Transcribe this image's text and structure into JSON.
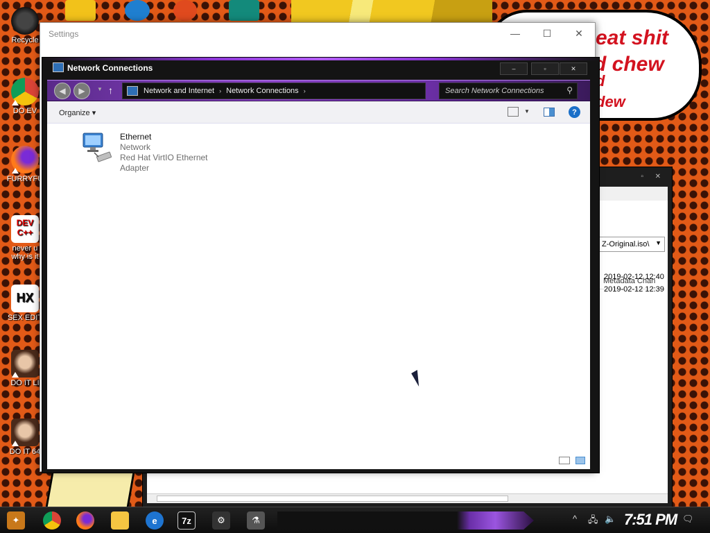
{
  "desktop": {
    "icons": [
      {
        "label": "Recycle"
      },
      {
        "label": "DO EV"
      },
      {
        "label": "FURRYFU"
      },
      {
        "label_line1": "never u",
        "label_line2": "why is it",
        "image_text": "DEV C++"
      },
      {
        "label": "SEX EDIT",
        "image_text": "HX"
      },
      {
        "label": "DO IT LI"
      },
      {
        "label": "DO IT 64"
      }
    ],
    "speech_bubble": [
      "eat shit",
      "d chew",
      "d",
      "dew"
    ]
  },
  "background_window": {
    "address_value": "Z-Original.iso\\",
    "column_header": "Metadata Chan",
    "rows": [
      "2019-02-12 12:40",
      "2019-02-12 12:39"
    ]
  },
  "settings": {
    "title": "Settings",
    "minimize": "—",
    "maximize": "☐",
    "close": "✕"
  },
  "network_window": {
    "title": "Network Connections",
    "controls": {
      "minimize": "–",
      "maximize": "▫",
      "close": "✕"
    },
    "breadcrumb": [
      "Network and Internet",
      "Network Connections"
    ],
    "search_placeholder": "Search Network Connections",
    "organize_label": "Organize",
    "help_label": "?",
    "connection": {
      "name": "Ethernet",
      "network": "Network",
      "adapter": "Red Hat VirtIO Ethernet Adapter"
    }
  },
  "taskbar": {
    "clock": "7:51 PM",
    "sevenzip_label": "7z",
    "tray_icons": [
      "chevron-up-icon",
      "network-icon",
      "speaker-icon"
    ],
    "notification_icon": "action-center-icon"
  },
  "colors": {
    "accent_purple": "#8c44c8",
    "desktop_orange": "#e25a17",
    "help_blue": "#1b6fc8"
  }
}
